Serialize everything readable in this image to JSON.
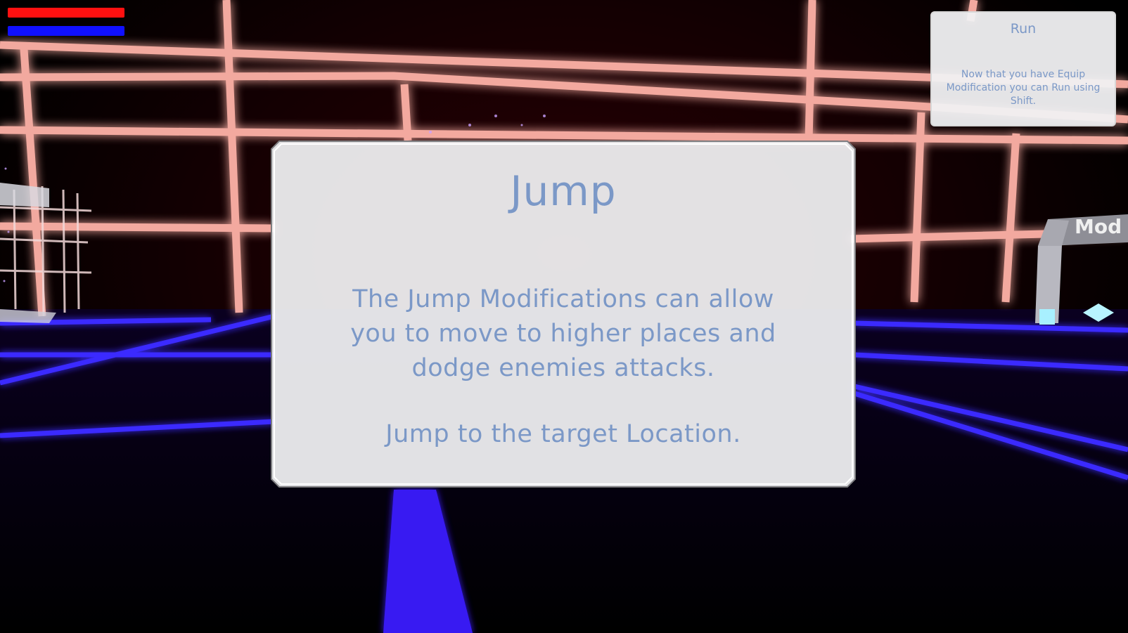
{
  "hud": {
    "health_color": "#ff1010",
    "energy_color": "#1010ff"
  },
  "tutorial": {
    "title": "Jump",
    "body": "The Jump Modifications can allow you to move to higher places and dodge enemies attacks.",
    "instruction": "Jump to the target Location.",
    "text_color": "#7b98c7"
  },
  "notice": {
    "title": "Run",
    "body": "Now that you have Equip Modification you can Run using Shift."
  },
  "world": {
    "sign_text": "Mod",
    "wall_grid_color": "#ff6a5c",
    "floor_grid_color": "#3a2bff"
  }
}
